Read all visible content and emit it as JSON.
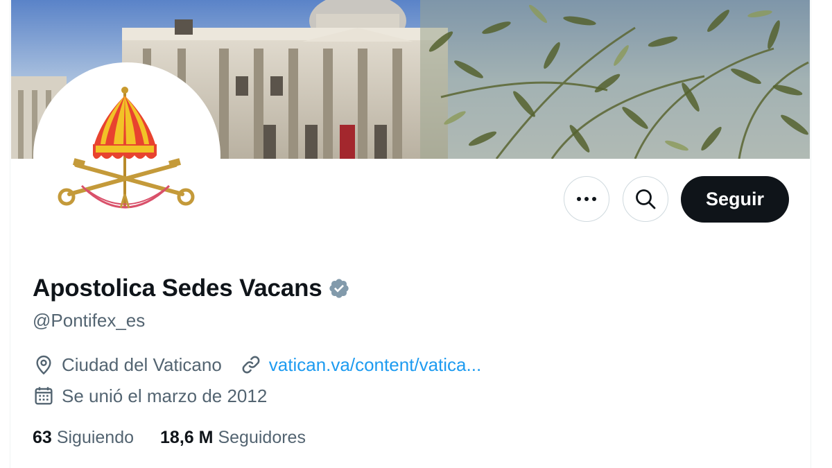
{
  "profile": {
    "display_name": "Apostolica Sedes Vacans",
    "handle": "@Pontifex_es",
    "location": "Ciudad del Vaticano",
    "website": "vatican.va/content/vatica...",
    "joined": "Se unió el marzo de 2012",
    "verified_badge_color": "#829aab"
  },
  "actions": {
    "more_icon": "more-horizontal-icon",
    "search_icon": "search-icon",
    "follow_label": "Seguir"
  },
  "stats": {
    "following_count": "63",
    "following_label": "Siguiendo",
    "followers_count": "18,6 M",
    "followers_label": "Seguidores"
  },
  "icons": {
    "location": "map-pin-icon",
    "link": "link-icon",
    "calendar": "calendar-icon",
    "verified": "verified-badge-icon"
  },
  "colors": {
    "text_primary": "#0f1419",
    "text_secondary": "#536471",
    "link": "#1d9bf0",
    "follow_button": "#0f1419"
  }
}
